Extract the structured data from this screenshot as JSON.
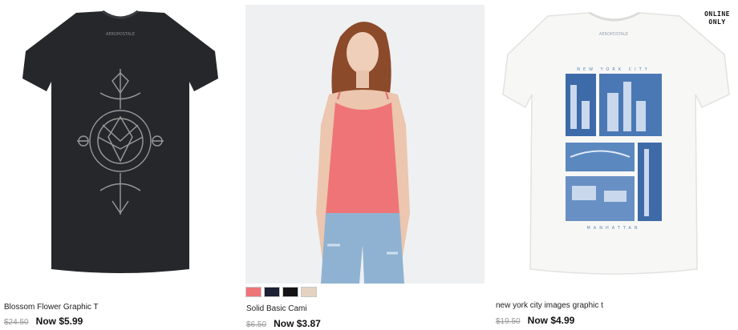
{
  "products": [
    {
      "name": "Blossom Flower Graphic T",
      "was_price": "$24.50",
      "now_price": "Now $5.99",
      "image_icon": "black-tshirt-lotus-graphic"
    },
    {
      "name": "Solid Basic Cami",
      "was_price": "$6.50",
      "now_price": "Now $3.87",
      "image_icon": "model-coral-cami",
      "swatches": [
        "#ef7478",
        "#1c2133",
        "#141414",
        "#e3d3c0"
      ]
    },
    {
      "name": "new york city images graphic t",
      "was_price": "$19.50",
      "now_price": "Now $4.99",
      "image_icon": "white-tshirt-nyc-photos",
      "badge_line1": "ONLINE",
      "badge_line2": "ONLY"
    }
  ]
}
